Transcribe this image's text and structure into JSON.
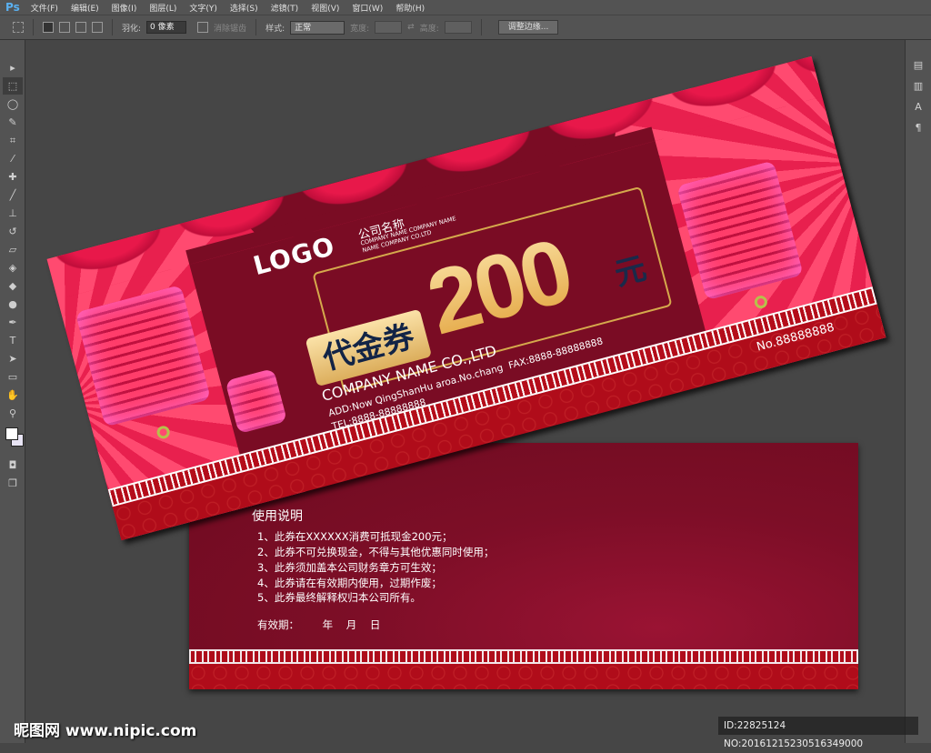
{
  "app": {
    "logo": "Ps",
    "menu": [
      "文件(F)",
      "编辑(E)",
      "图像(I)",
      "图层(L)",
      "文字(Y)",
      "选择(S)",
      "滤镜(T)",
      "视图(V)",
      "窗口(W)",
      "帮助(H)"
    ]
  },
  "options": {
    "feather_label": "羽化:",
    "feather_value": "0 像素",
    "antialias_label": "消除锯齿",
    "style_label": "样式:",
    "style_value": "正常",
    "width_label": "宽度:",
    "height_label": "高度:",
    "refine_button": "调整边缘..."
  },
  "tools": [
    "move-icon",
    "marquee-icon",
    "lasso-icon",
    "quick-select-icon",
    "crop-icon",
    "eyedropper-icon",
    "healing-icon",
    "brush-icon",
    "stamp-icon",
    "history-brush-icon",
    "eraser-icon",
    "paint-bucket-icon",
    "blur-icon",
    "dodge-icon",
    "pen-icon",
    "type-icon",
    "path-select-icon",
    "shape-icon",
    "hand-icon",
    "zoom-icon"
  ],
  "front": {
    "logo": "LOGO",
    "company_cn": "公司名称",
    "company_sub1": "COMPANY NAME COMPANY NAME",
    "company_sub2": "NAME COMPANY CO.LTD",
    "amount": "200",
    "currency": "元",
    "voucher": "代金券",
    "company_en": "COMPANY NAME CO.,LTD",
    "address": "ADD:Now QingShanHu aroa.No.chang",
    "fax": "FAX:8888-88888888",
    "tel": "TEL:8888-88888888",
    "serial": "No.88888888"
  },
  "back": {
    "title": "使用说明",
    "rules": [
      "1、此券在XXXXXX消费可抵现金200元；",
      "2、此券不可兑换现金，不得与其他优惠同时使用；",
      "3、此券须加盖本公司财务章方可生效；",
      "4、此券请在有效期内使用，过期作废；",
      "5、此券最终解释权归本公司所有。"
    ],
    "validity": "有效期：       年    月    日"
  },
  "watermark": {
    "left": "昵图网 www.nipic.com",
    "right": "ID:22825124 NO:20161215230516349000"
  },
  "colors": {
    "card": "#7a0c24",
    "gold": "#e2a23c",
    "navy": "#122446",
    "fret": "#b40d1a"
  }
}
